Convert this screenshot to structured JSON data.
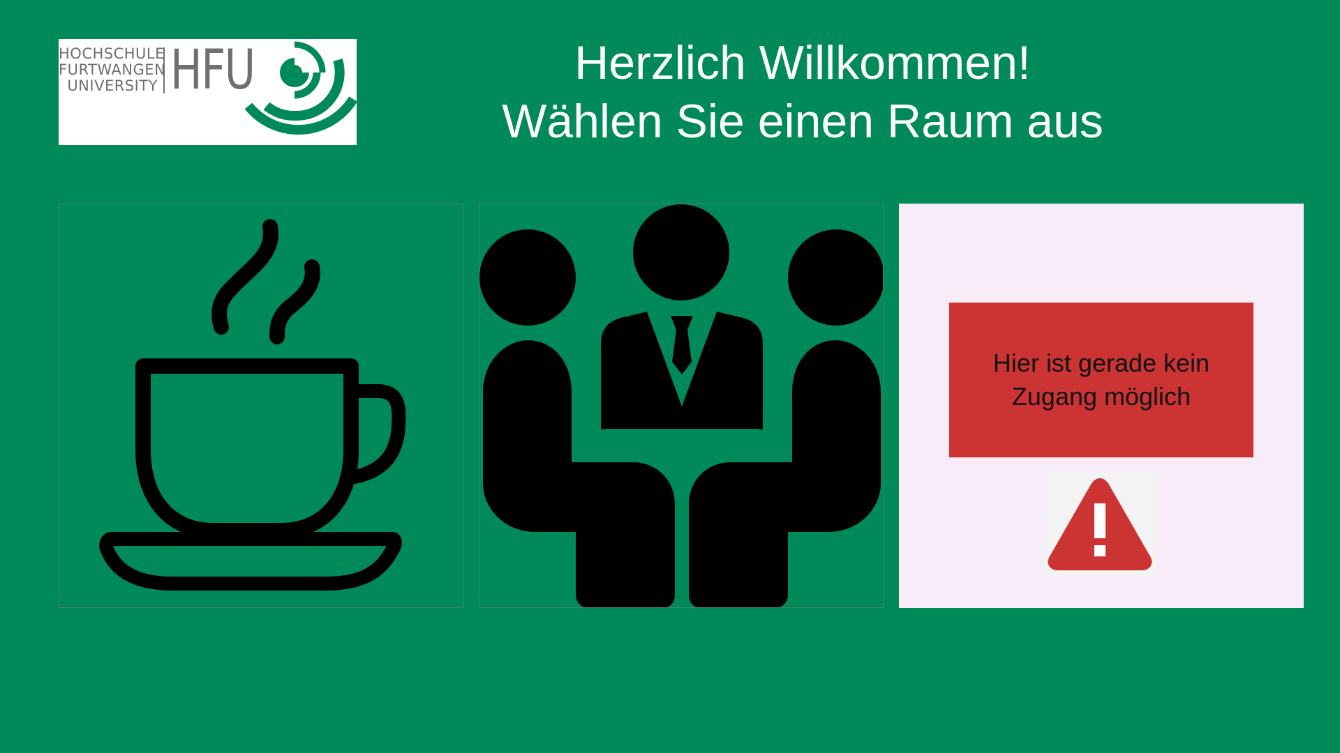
{
  "window": {
    "background_color": "#008a5a"
  },
  "logo": {
    "line1": "HOCHSCHULE",
    "line2": "FURTWANGEN",
    "line3": "UNIVERSITY",
    "abbr": "HFU",
    "text_color": "#6f6f6f",
    "mark_color": "#008a5a"
  },
  "heading": {
    "line1": "Herzlich Willkommen!",
    "line2": "Wählen Sie einen Raum aus"
  },
  "rooms": [
    {
      "icon": "coffee-cup-icon",
      "available": true
    },
    {
      "icon": "meeting-people-icon",
      "available": true
    },
    {
      "icon": "warning-icon",
      "available": false,
      "notice": "Hier ist gerade kein Zugang möglich",
      "notice_color": "#cc3333",
      "tile_color": "#f8ecf8"
    }
  ]
}
